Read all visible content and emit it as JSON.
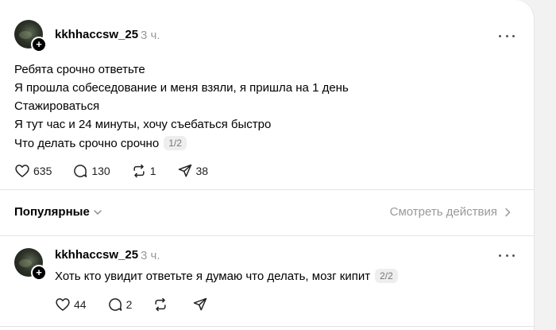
{
  "post1": {
    "username": "kkhhaccsw_25",
    "time": "3 ч.",
    "lines": [
      "Ребята срочно ответьте",
      "Я прошла собеседование и меня взяли, я пришла на 1 день",
      "Стажироваться",
      "Я тут час и 24 минуты, хочу съебаться быстро",
      "Что делать срочно срочно"
    ],
    "pager": "1/2",
    "likes": "635",
    "comments": "130",
    "reposts": "1",
    "shares": "38"
  },
  "filter": {
    "label": "Популярные",
    "view_activity": "Смотреть действия"
  },
  "post2": {
    "username": "kkhhaccsw_25",
    "time": "3 ч.",
    "text": "Хоть кто увидит ответьте я думаю что делать, мозг кипит",
    "pager": "2/2",
    "likes": "44",
    "comments": "2"
  },
  "icons": {
    "like": "heart-icon",
    "comment": "comment-icon",
    "repost": "repost-icon",
    "share": "send-icon",
    "more": "more-icon",
    "follow": "plus-icon"
  }
}
